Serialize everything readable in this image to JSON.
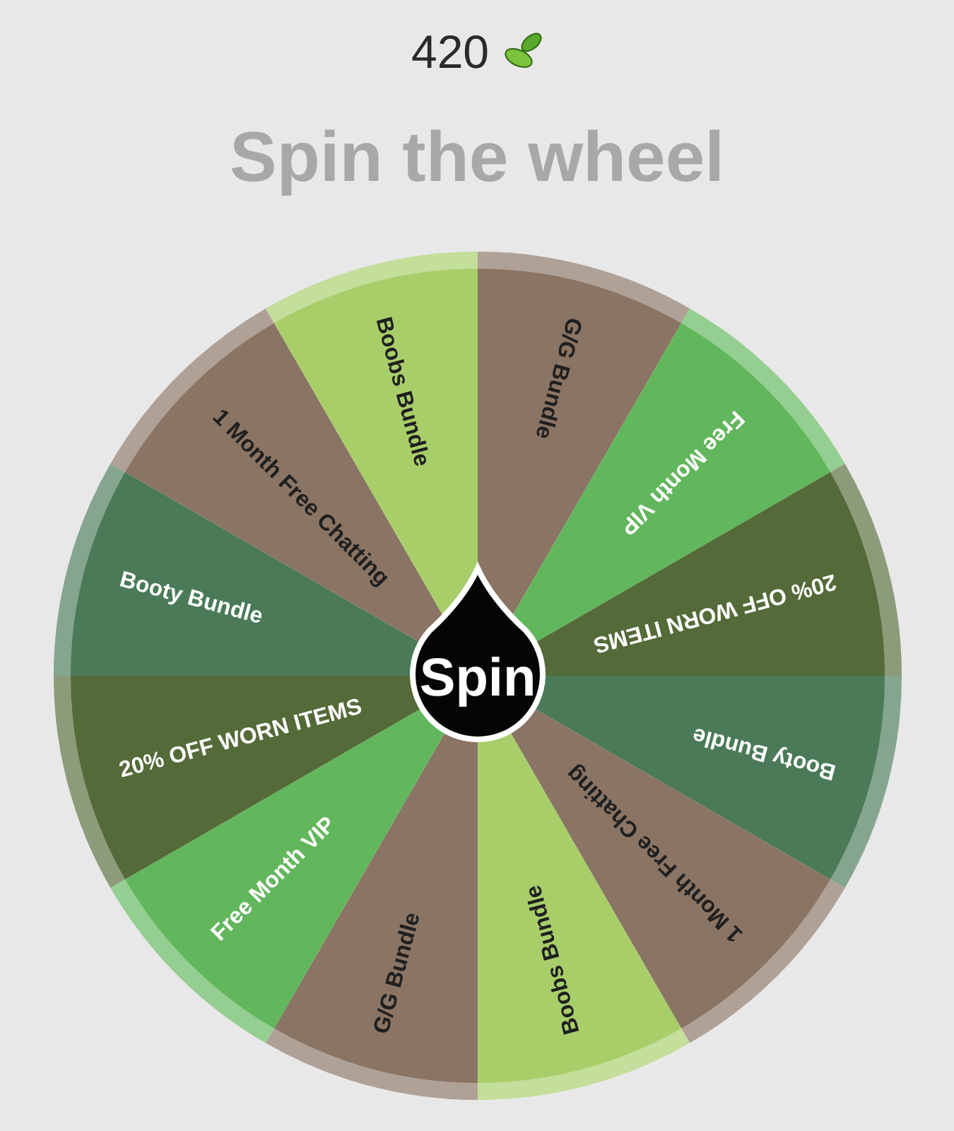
{
  "balance": {
    "amount": "420"
  },
  "title": "Spin the wheel",
  "wheel": {
    "segments": [
      {
        "label": "G/G Bundle",
        "color": "#8a7464"
      },
      {
        "label": "Free Month VIP",
        "color": "#62b65c"
      },
      {
        "label": "20% OFF WORN ITEMS",
        "color": "#546a38"
      },
      {
        "label": "Booty Bundle",
        "color": "#4a7a58"
      },
      {
        "label": "1 Month Free Chatting",
        "color": "#8a7464"
      },
      {
        "label": "Boobs Bundle",
        "color": "#a8ce6a"
      },
      {
        "label": "G/G Bundle",
        "color": "#8a7464"
      },
      {
        "label": "Free Month VIP",
        "color": "#62b65c"
      },
      {
        "label": "20% OFF WORN ITEMS",
        "color": "#546a38"
      },
      {
        "label": "Booty Bundle",
        "color": "#4a7a58"
      },
      {
        "label": "1 Month Free Chatting",
        "color": "#8a7464"
      },
      {
        "label": "Boobs Bundle",
        "color": "#a8ce6a"
      }
    ]
  },
  "spin_button": {
    "label": "Spin"
  }
}
